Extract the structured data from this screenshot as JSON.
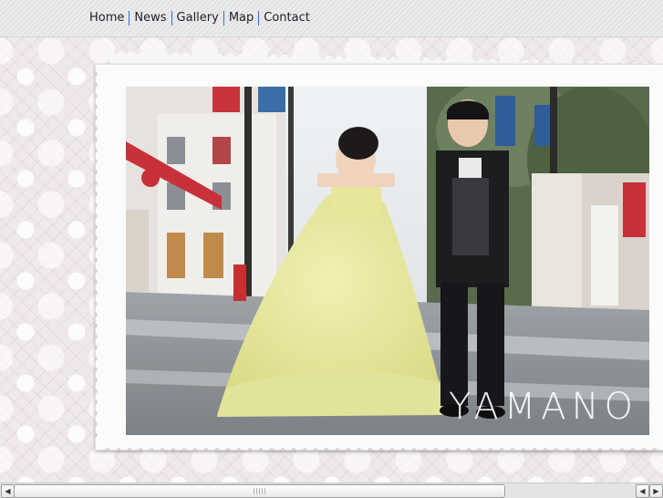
{
  "nav": {
    "items": [
      "Home",
      "News",
      "Gallery",
      "Map",
      "Contact"
    ],
    "separator_color": "#2b74c9"
  },
  "gallery": {
    "photo_watermark": "YAMANO"
  },
  "scrollbar": {
    "left_arrow": "◀",
    "right_arrow": "▶",
    "right_arrow_alt": "◀"
  }
}
